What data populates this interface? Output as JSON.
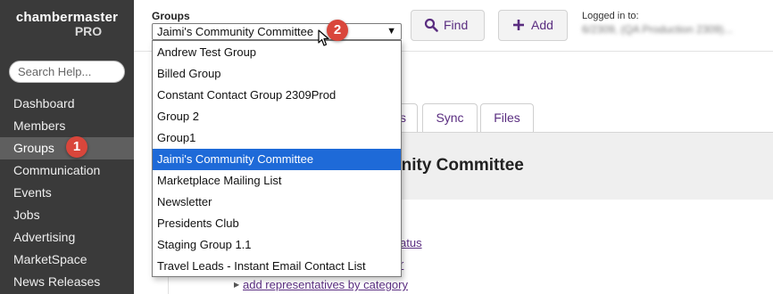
{
  "app": {
    "logo_line1": "chambermaster",
    "logo_line2": "PRO"
  },
  "sidebar": {
    "search_placeholder": "Search Help...",
    "items": [
      {
        "label": "Dashboard"
      },
      {
        "label": "Members"
      },
      {
        "label": "Groups",
        "active": true
      },
      {
        "label": "Communication"
      },
      {
        "label": "Events"
      },
      {
        "label": "Jobs"
      },
      {
        "label": "Advertising"
      },
      {
        "label": "MarketSpace"
      },
      {
        "label": "News Releases"
      }
    ]
  },
  "annotations": {
    "badge1": "1",
    "badge2": "2",
    "color": "#d9463b"
  },
  "topbar": {
    "groups_label": "Groups",
    "selected_group": "Jaimi's Community Committee",
    "find_label": "Find",
    "add_label": "Add",
    "logged_in_label": "Logged in to:",
    "logged_in_value": "6/2309, (QA Production 2309)..."
  },
  "dropdown": {
    "options": [
      "Andrew Test Group",
      "Billed Group",
      "Constant Contact Group 2309Prod",
      "Group 2",
      "Group1",
      "Jaimi's Community Committee",
      "Marketplace Mailing List",
      "Newsletter",
      "Presidents Club",
      "Staging Group 1.1",
      "Travel Leads - Instant Email Contact List"
    ],
    "selected": "Jaimi's Community Committee",
    "highlight_color": "#1e6ad8"
  },
  "main": {
    "tab_partial": "s",
    "tabs": [
      {
        "label": "Sync"
      },
      {
        "label": "Files"
      }
    ],
    "title_partial": "unity Committee",
    "links": {
      "status_partial": "atus",
      "r_partial": "r",
      "add_reps": "add representatives by category"
    }
  },
  "colors": {
    "sidebar_bg": "#3a3a3a",
    "accent_purple": "#5a2d80"
  }
}
